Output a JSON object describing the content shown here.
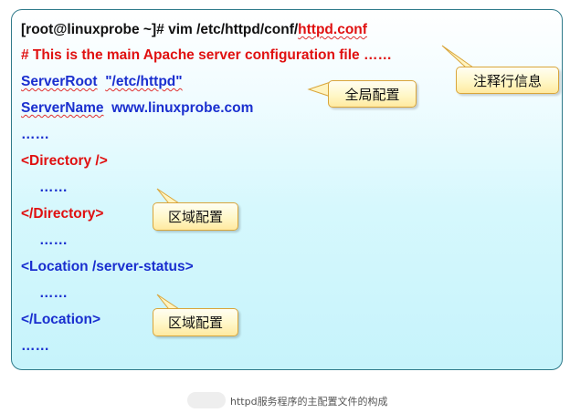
{
  "config": {
    "cmd_prefix": "[root@linuxprobe ~]# vim /etc/httpd/conf/",
    "cmd_file": "httpd.conf",
    "comment_line": "# This is the main Apache server configuration file ……",
    "server_root_key": "ServerRoot",
    "server_root_value": "\"/etc/httpd\"",
    "server_name_key": "ServerName",
    "server_name_value": "www.linuxprobe.com",
    "ellipsis_1": "……",
    "dir_open": "<Directory  />",
    "dir_body": "……",
    "dir_close": "</Directory>",
    "gap_1": "……",
    "loc_open": "<Location /server-status>",
    "loc_body": "……",
    "loc_close": "</Location>",
    "ellipsis_end": "……"
  },
  "callouts": {
    "comment": "注释行信息",
    "global": "全局配置",
    "region_1": "区域配置",
    "region_2": "区域配置"
  },
  "caption": "httpd服务程序的主配置文件的构成"
}
